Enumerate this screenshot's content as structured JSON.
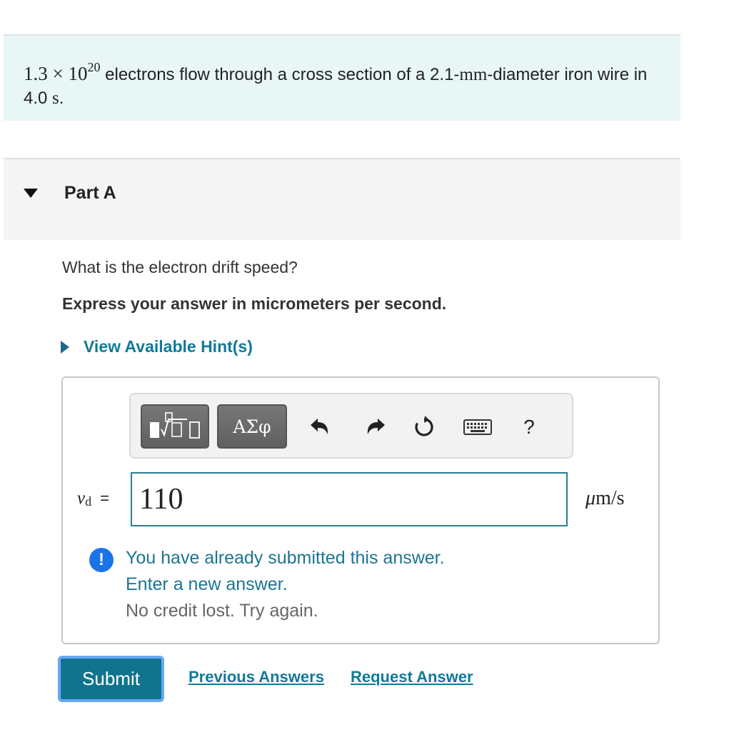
{
  "problem": {
    "math_count": "1.3 × 10",
    "math_exp": "20",
    "text_1": " electrons flow through a cross section of a 2.1-",
    "unit_mm": "mm",
    "text_2": "-diameter iron wire in 4.0 ",
    "unit_s": "s",
    "text_3": "."
  },
  "part": {
    "title": "Part A",
    "question": "What is the electron drift speed?",
    "instruction": "Express your answer in micrometers per second.",
    "hint_link": "View Available Hint(s)"
  },
  "toolbar": {
    "greek_label": "ΑΣφ",
    "help_label": "?"
  },
  "answer": {
    "variable": "v",
    "variable_sub": "d",
    "equals": "=",
    "value": "110",
    "unit_mu": "μ",
    "unit_rest": "m/s"
  },
  "feedback": {
    "icon": "!",
    "line1": "You have already submitted this answer.",
    "line2": "Enter a new answer.",
    "line3": "No credit lost. Try again."
  },
  "actions": {
    "submit": "Submit",
    "previous_answers": "Previous Answers",
    "request_answer": "Request Answer"
  },
  "colors": {
    "accent": "#11748f",
    "link": "#0f7a9a",
    "problem_bg": "#e8f6f6",
    "info_icon": "#1a73e8"
  },
  "icons": [
    "caret-down-icon",
    "caret-right-icon",
    "templates-icon",
    "undo-icon",
    "redo-icon",
    "reset-icon",
    "keyboard-icon",
    "help-icon",
    "info-icon"
  ]
}
